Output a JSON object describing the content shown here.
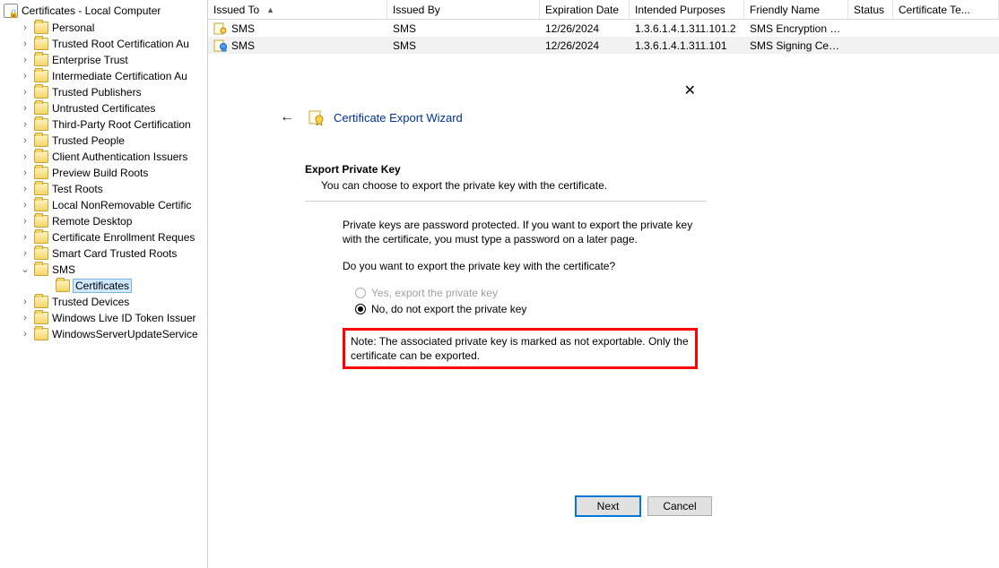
{
  "tree": {
    "root": "Certificates - Local Computer",
    "items": [
      {
        "label": "Personal"
      },
      {
        "label": "Trusted Root Certification Au"
      },
      {
        "label": "Enterprise Trust"
      },
      {
        "label": "Intermediate Certification Au"
      },
      {
        "label": "Trusted Publishers"
      },
      {
        "label": "Untrusted Certificates"
      },
      {
        "label": "Third-Party Root Certification"
      },
      {
        "label": "Trusted People"
      },
      {
        "label": "Client Authentication Issuers"
      },
      {
        "label": "Preview Build Roots"
      },
      {
        "label": "Test Roots"
      },
      {
        "label": "Local NonRemovable Certific"
      },
      {
        "label": "Remote Desktop"
      },
      {
        "label": "Certificate Enrollment Reques"
      },
      {
        "label": "Smart Card Trusted Roots"
      },
      {
        "label": "SMS",
        "expanded": true
      },
      {
        "label": "Certificates",
        "selected": true,
        "child": true
      },
      {
        "label": "Trusted Devices"
      },
      {
        "label": "Windows Live ID Token Issuer"
      },
      {
        "label": "WindowsServerUpdateService"
      }
    ]
  },
  "list": {
    "headers": {
      "issued_to": "Issued To",
      "issued_by": "Issued By",
      "expiration": "Expiration Date",
      "purposes": "Intended Purposes",
      "friendly": "Friendly Name",
      "status": "Status",
      "template": "Certificate Te..."
    },
    "rows": [
      {
        "issued_to": "SMS",
        "issued_by": "SMS",
        "expiration": "12/26/2024",
        "purposes": "1.3.6.1.4.1.311.101.2",
        "friendly": "SMS Encryption Cer...",
        "selected": false,
        "variant": "enc"
      },
      {
        "issued_to": "SMS",
        "issued_by": "SMS",
        "expiration": "12/26/2024",
        "purposes": "1.3.6.1.4.1.311.101",
        "friendly": "SMS Signing Certifi...",
        "selected": true,
        "variant": "sign"
      }
    ]
  },
  "wizard": {
    "title": "Certificate Export Wizard",
    "section_title": "Export Private Key",
    "section_sub": "You can choose to export the private key with the certificate.",
    "p1": "Private keys are password protected. If you want to export the private key with the certificate, you must type a password on a later page.",
    "p2": "Do you want to export the private key with the certificate?",
    "radio_yes": "Yes, export the private key",
    "radio_no": "No, do not export the private key",
    "note": "Note: The associated private key is marked as not exportable. Only the certificate can be exported.",
    "btn_next": "Next",
    "btn_cancel": "Cancel"
  }
}
